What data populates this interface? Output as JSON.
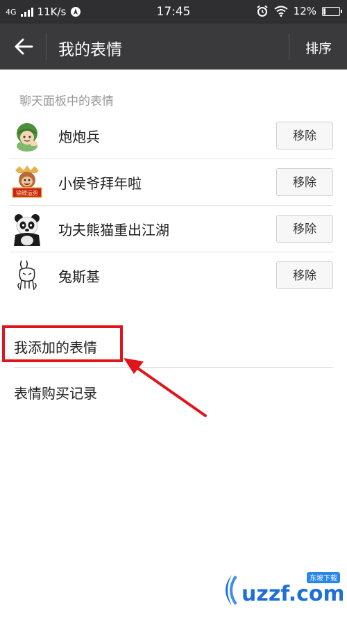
{
  "status_bar": {
    "network": "4G",
    "speed": "11K/s",
    "time": "17:45",
    "battery": "12%",
    "battery_level": 0.12
  },
  "app_bar": {
    "back_icon": "arrow-left-icon",
    "title": "我的表情",
    "sort_label": "排序"
  },
  "chat_panel": {
    "section_label": "聊天面板中的表情",
    "items": [
      {
        "name": "炮炮兵",
        "action": "移除"
      },
      {
        "name": "小侯爷拜年啦",
        "action": "移除"
      },
      {
        "name": "功夫熊猫重出江湖",
        "action": "移除"
      },
      {
        "name": "兔斯基",
        "action": "移除"
      }
    ]
  },
  "links": {
    "added": "我添加的表情",
    "purchase_history": "表情购买记录"
  },
  "sticker_badge": "锦鲤运势",
  "watermark": {
    "brand": "uzzf.com",
    "tag": "东坡下载"
  },
  "colors": {
    "status_bar_bg": "#2f2f31",
    "app_bar_bg": "#3a3a3c",
    "highlight_red": "#e0141a",
    "watermark_blue": "#1e6fd9"
  }
}
